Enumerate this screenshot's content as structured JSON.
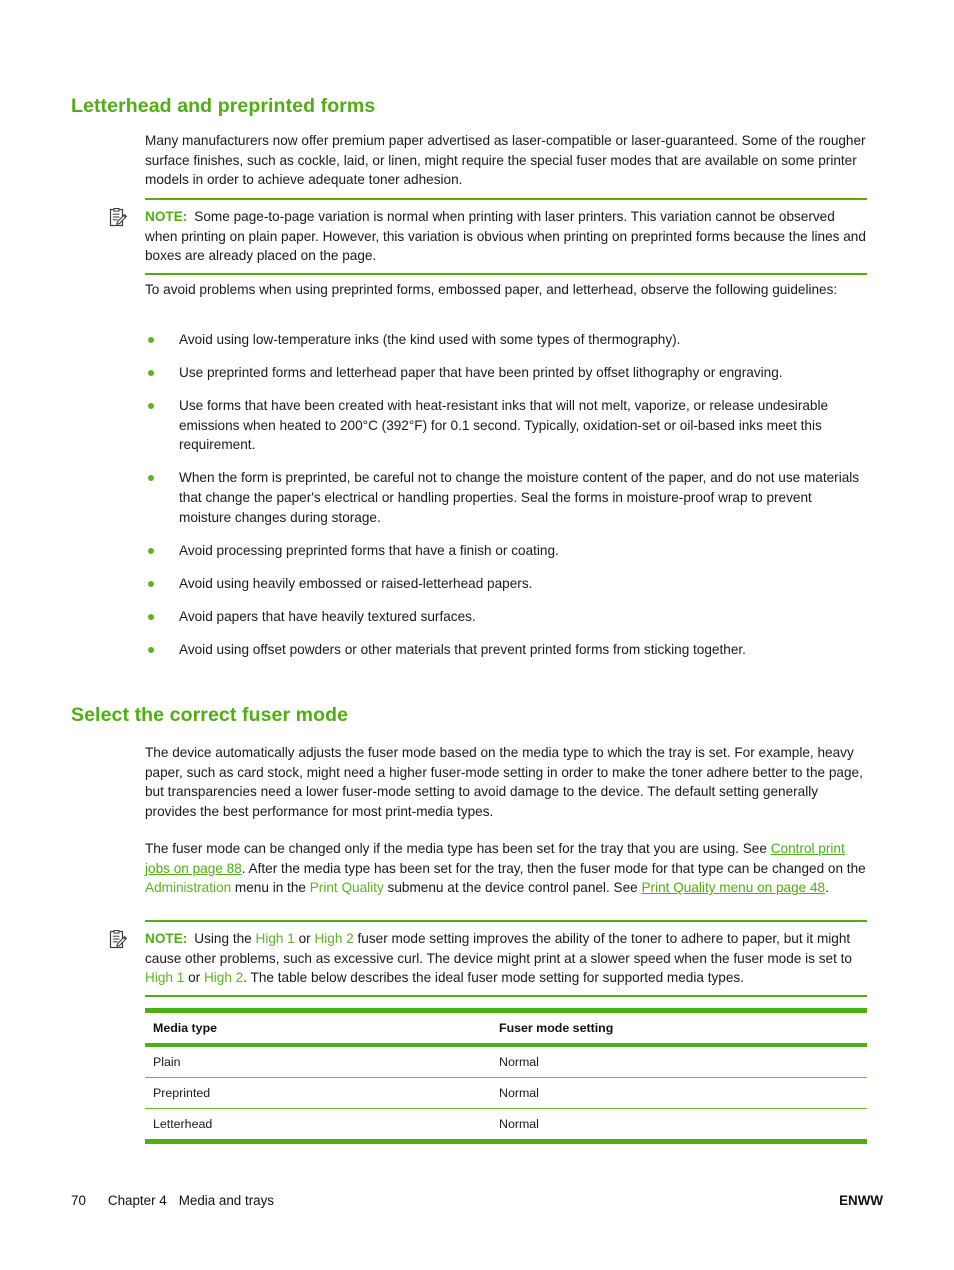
{
  "document": {
    "headings": {
      "letterhead": "Letterhead and preprinted forms",
      "fuser": "Select the correct fuser mode"
    },
    "paragraphs": {
      "intro": "Many manufacturers now offer premium paper advertised as laser-compatible or laser-guaranteed. Some of the rougher surface finishes, such as cockle, laid, or linen, might require the special fuser modes that are available on some printer models in order to achieve adequate toner adhesion.",
      "guidelines_lead": "To avoid problems when using preprinted forms, embossed paper, and letterhead, observe the following guidelines:",
      "fuser_intro": "The device automatically adjusts the fuser mode based on the media type to which the tray is set. For example, heavy paper, such as card stock, might need a higher fuser-mode setting in order to make the toner adhere better to the page, but transparencies need a lower fuser-mode setting to avoid damage to the device. The default setting generally provides the best performance for most print-media types."
    },
    "fuser_change": {
      "part1": "The fuser mode can be changed only if the media type has been set for the tray that you are using. See ",
      "link1": "Control print jobs on page 88",
      "part2": ". After the media type has been set for the tray, then the fuser mode for that type can be changed on the ",
      "term1": "Administration",
      "part3": " menu in the ",
      "term2": "Print Quality",
      "part4": " submenu at the device control panel. See ",
      "link2": "Print Quality menu on page 48",
      "part5": "."
    },
    "notes": [
      {
        "label": "NOTE:",
        "icon": "note-clipboard-icon",
        "text": "Some page-to-page variation is normal when printing with laser printers. This variation cannot be observed when printing on plain paper. However, this variation is obvious when printing on preprinted forms because the lines and boxes are already placed on the page."
      },
      {
        "label": "NOTE:",
        "icon": "note-clipboard-icon",
        "part1": "Using the ",
        "term1": "High 1",
        "part2": " or ",
        "term2": "High 2",
        "part3": " fuser mode setting improves the ability of the toner to adhere to paper, but it might cause other problems, such as excessive curl. The device might print at a slower speed when the fuser mode is set to ",
        "term3": "High 1",
        "part4": " or ",
        "term4": "High 2",
        "part5": ". The table below describes the ideal fuser mode setting for supported media types."
      }
    ],
    "bullets": [
      "Avoid using low-temperature inks (the kind used with some types of thermography).",
      "Use preprinted forms and letterhead paper that have been printed by offset lithography or engraving.",
      "Use forms that have been created with heat-resistant inks that will not melt, vaporize, or release undesirable emissions when heated to 200°C (392°F) for 0.1 second. Typically, oxidation-set or oil-based inks meet this requirement.",
      "When the form is preprinted, be careful not to change the moisture content of the paper, and do not use materials that change the paper's electrical or handling properties. Seal the forms in moisture-proof wrap to prevent moisture changes during storage.",
      "Avoid processing preprinted forms that have a finish or coating.",
      "Avoid using heavily embossed or raised-letterhead papers.",
      "Avoid papers that have heavily textured surfaces.",
      "Avoid using offset powders or other materials that prevent printed forms from sticking together."
    ],
    "table": {
      "headers": [
        "Media type",
        "Fuser mode setting"
      ],
      "rows": [
        [
          "Plain",
          "Normal"
        ],
        [
          "Preprinted",
          "Normal"
        ],
        [
          "Letterhead",
          "Normal"
        ]
      ]
    },
    "footer": {
      "page_number": "70",
      "chapter": "Chapter 4",
      "chapter_title": "Media and trays",
      "right": "ENWW"
    },
    "colors": {
      "heading_green": "#4FAE10",
      "bullet_green": "#5CB423",
      "rule_green": "#4FAE10",
      "link_green": "#4FAE10"
    }
  }
}
